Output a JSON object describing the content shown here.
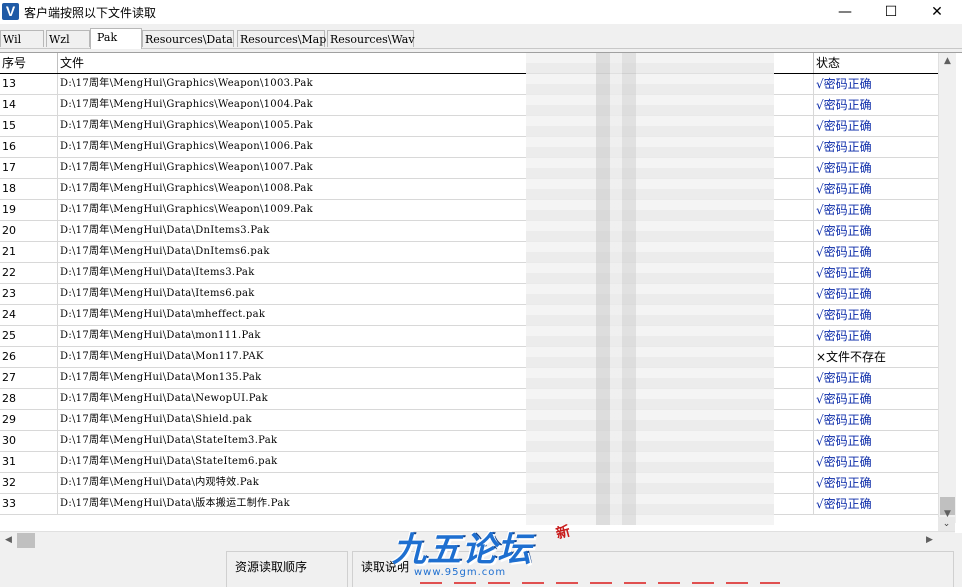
{
  "window": {
    "title": "客户端按照以下文件读取",
    "icon": "V",
    "controls": {
      "minimize": "—",
      "maximize": "☐",
      "close": "✕"
    }
  },
  "tabs": [
    {
      "label": "Wil",
      "active": false
    },
    {
      "label": "Wzl",
      "active": false
    },
    {
      "label": "Pak",
      "active": true
    },
    {
      "label": "Resources\\Data",
      "active": false
    },
    {
      "label": "Resources\\Map",
      "active": false
    },
    {
      "label": "Resources\\Wav",
      "active": false
    }
  ],
  "table": {
    "columns": {
      "index": "序号",
      "file": "文件",
      "status": "状态"
    },
    "rows": [
      {
        "index": "13",
        "file": "D:\\17周年\\MengHui\\Graphics\\Weapon\\1003.Pak",
        "status": "√密码正确",
        "ok": true
      },
      {
        "index": "14",
        "file": "D:\\17周年\\MengHui\\Graphics\\Weapon\\1004.Pak",
        "status": "√密码正确",
        "ok": true
      },
      {
        "index": "15",
        "file": "D:\\17周年\\MengHui\\Graphics\\Weapon\\1005.Pak",
        "status": "√密码正确",
        "ok": true
      },
      {
        "index": "16",
        "file": "D:\\17周年\\MengHui\\Graphics\\Weapon\\1006.Pak",
        "status": "√密码正确",
        "ok": true
      },
      {
        "index": "17",
        "file": "D:\\17周年\\MengHui\\Graphics\\Weapon\\1007.Pak",
        "status": "√密码正确",
        "ok": true
      },
      {
        "index": "18",
        "file": "D:\\17周年\\MengHui\\Graphics\\Weapon\\1008.Pak",
        "status": "√密码正确",
        "ok": true
      },
      {
        "index": "19",
        "file": "D:\\17周年\\MengHui\\Graphics\\Weapon\\1009.Pak",
        "status": "√密码正确",
        "ok": true
      },
      {
        "index": "20",
        "file": "D:\\17周年\\MengHui\\Data\\DnItems3.Pak",
        "status": "√密码正确",
        "ok": true
      },
      {
        "index": "21",
        "file": "D:\\17周年\\MengHui\\Data\\DnItems6.pak",
        "status": "√密码正确",
        "ok": true
      },
      {
        "index": "22",
        "file": "D:\\17周年\\MengHui\\Data\\Items3.Pak",
        "status": "√密码正确",
        "ok": true
      },
      {
        "index": "23",
        "file": "D:\\17周年\\MengHui\\Data\\Items6.pak",
        "status": "√密码正确",
        "ok": true
      },
      {
        "index": "24",
        "file": "D:\\17周年\\MengHui\\Data\\mheffect.pak",
        "status": "√密码正确",
        "ok": true
      },
      {
        "index": "25",
        "file": "D:\\17周年\\MengHui\\Data\\mon111.Pak",
        "status": "√密码正确",
        "ok": true
      },
      {
        "index": "26",
        "file": "D:\\17周年\\MengHui\\Data\\Mon117.PAK",
        "status": "×文件不存在",
        "ok": false
      },
      {
        "index": "27",
        "file": "D:\\17周年\\MengHui\\Data\\Mon135.Pak",
        "status": "√密码正确",
        "ok": true
      },
      {
        "index": "28",
        "file": "D:\\17周年\\MengHui\\Data\\NewopUI.Pak",
        "status": "√密码正确",
        "ok": true
      },
      {
        "index": "29",
        "file": "D:\\17周年\\MengHui\\Data\\Shield.pak",
        "status": "√密码正确",
        "ok": true
      },
      {
        "index": "30",
        "file": "D:\\17周年\\MengHui\\Data\\StateItem3.Pak",
        "status": "√密码正确",
        "ok": true
      },
      {
        "index": "31",
        "file": "D:\\17周年\\MengHui\\Data\\StateItem6.pak",
        "status": "√密码正确",
        "ok": true
      },
      {
        "index": "32",
        "file": "D:\\17周年\\MengHui\\Data\\内观特效.Pak",
        "status": "√密码正确",
        "ok": true
      },
      {
        "index": "33",
        "file": "D:\\17周年\\MengHui\\Data\\版本搬运工制作.Pak",
        "status": "√密码正确",
        "ok": true
      }
    ]
  },
  "scrollbars": {
    "up": "▲",
    "down": "▼",
    "left": "◀",
    "right": "▶",
    "corner": "⌄"
  },
  "bottom": {
    "load_order_title": "资源读取顺序",
    "note_title": "读取说明"
  },
  "watermark": {
    "logo": "九五论坛",
    "url": "www.95gm.com",
    "badge": "新"
  },
  "colors": {
    "status_ok": "#0a2aa8",
    "status_bad": "#000000"
  }
}
